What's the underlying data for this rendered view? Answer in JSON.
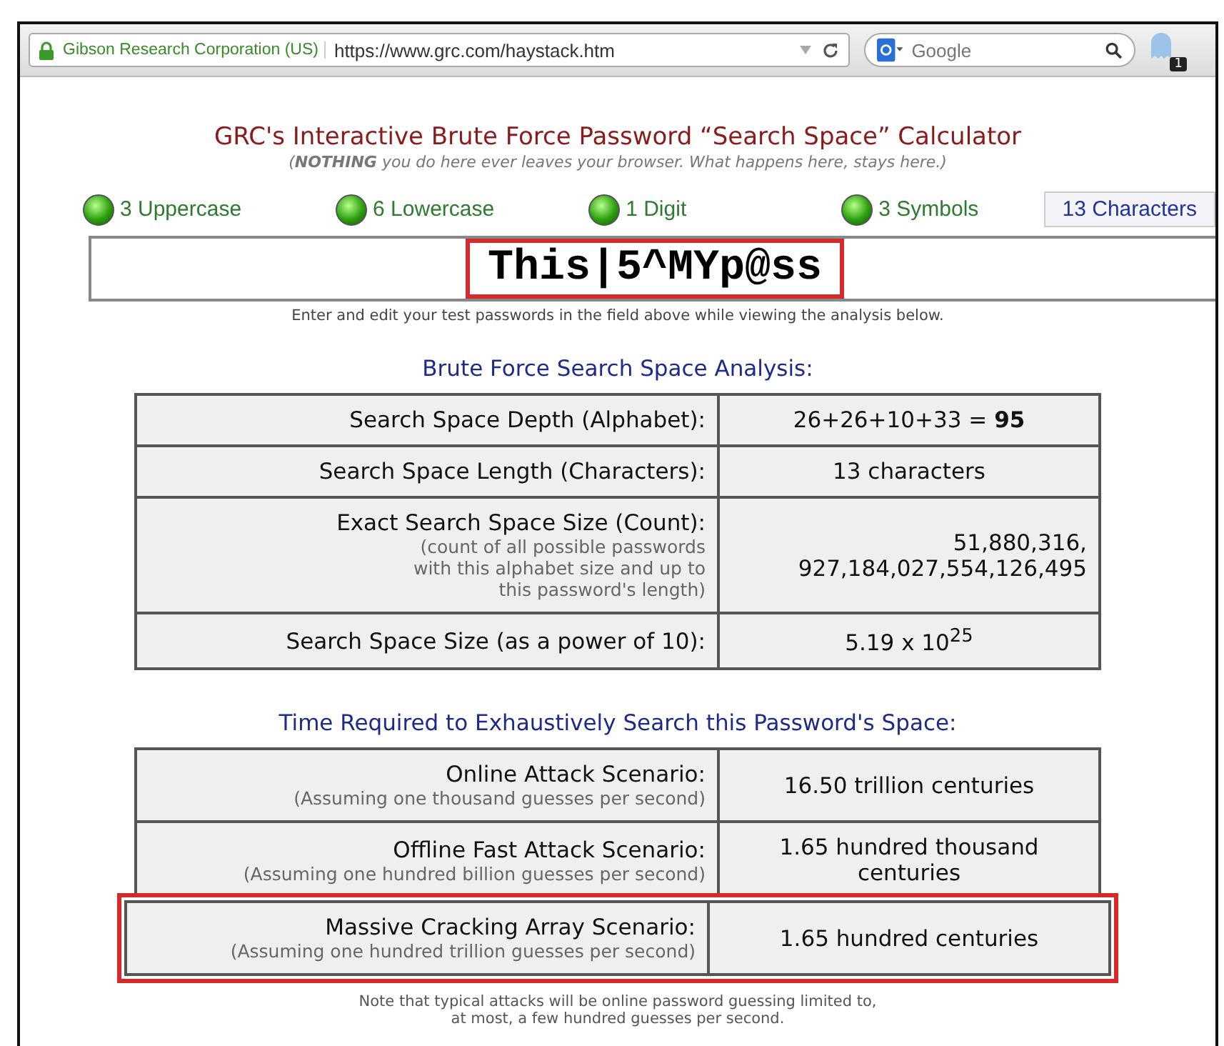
{
  "browser": {
    "site_identity": "Gibson Research Corporation (US)",
    "url": "https://www.grc.com/haystack.htm",
    "search_engine_placeholder": "Google",
    "extension_badge": "1"
  },
  "page": {
    "title": "GRC's Interactive Brute Force Password “Search Space” Calculator",
    "subtitle": "(**NOTHING** you do here ever leaves your browser. What happens here, stays here.)"
  },
  "indicators": [
    {
      "label": "3 Uppercase",
      "on": true
    },
    {
      "label": "6 Lowercase",
      "on": true
    },
    {
      "label": "1 Digit",
      "on": true
    },
    {
      "label": "3 Symbols",
      "on": true
    }
  ],
  "character_count": "13 Characters",
  "password_field": {
    "value": "This|5^MYp@ss",
    "highlighted": true
  },
  "field_hint": "Enter and edit your test passwords in the field above while viewing the analysis below.",
  "analysis": {
    "heading": "Brute Force Search Space Analysis:",
    "rows": [
      {
        "kind": "plain",
        "label": "Search Space Depth (Alphabet):",
        "value": "26+26+10+33 = **95**"
      },
      {
        "kind": "plain",
        "label": "Search Space Length (Characters):",
        "value": "13 characters"
      },
      {
        "kind": "count",
        "label": "Exact Search Space Size (Count):",
        "note": "(count of all possible passwords with this alphabet size and up to this password's length)",
        "value": "51,880,316, 927,184,027,554,126,495"
      },
      {
        "kind": "plain",
        "label": "Search Space Size (as a power of 10):",
        "value": "5.19 x 10$^{25}$"
      }
    ]
  },
  "time_required": {
    "heading": "Time Required to Exhaustively Search this Password's Space:",
    "rows": [
      {
        "label": "Online Attack Scenario:",
        "note": "(Assuming one thousand guesses per second)",
        "value": "16.50 trillion centuries",
        "highlighted": false
      },
      {
        "label": "Offline Fast Attack Scenario:",
        "note": "(Assuming one hundred billion guesses per second)",
        "value": "1.65 hundred thousand centuries",
        "highlighted": false
      },
      {
        "label": "Massive Cracking Array Scenario:",
        "note": "(Assuming one hundred trillion guesses per second)",
        "value": "1.65 hundred centuries",
        "highlighted": true
      }
    ]
  },
  "footnote": "Note that typical attacks will be online password guessing limited to, at most, a few hundred guesses per second."
}
